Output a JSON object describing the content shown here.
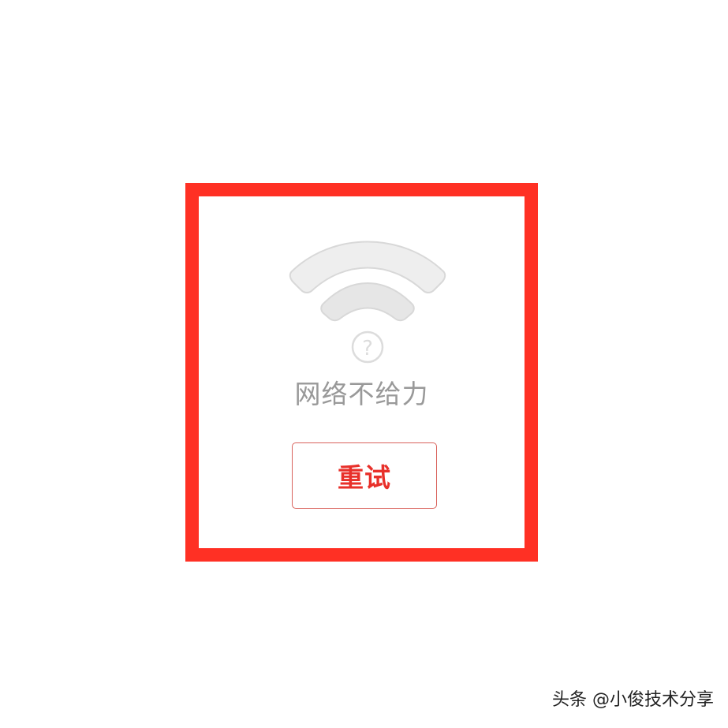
{
  "error_card": {
    "message": "网络不给力",
    "retry_label": "重试",
    "icon": "wifi-question-icon"
  },
  "watermark": {
    "text": "头条 @小俊技术分享"
  },
  "colors": {
    "frame": "#ff3024",
    "accent": "#e8302a",
    "button_border": "#d9625c",
    "muted_text": "#999999",
    "icon_fill": "#eeeeee",
    "icon_stroke": "#d8d8d8"
  }
}
